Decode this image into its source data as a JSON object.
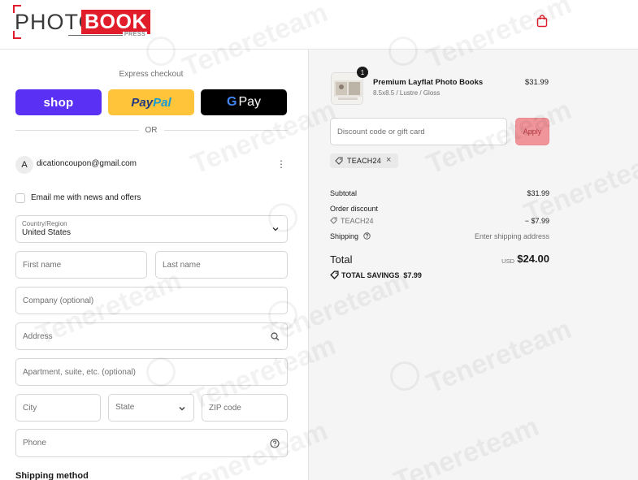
{
  "brand": {
    "photo_text": "PHOTO",
    "book_text": "BOOK",
    "press_text": "PRESS",
    "accent_color": "#e11d2b"
  },
  "header": {
    "cart_icon": "shopping-bag-icon"
  },
  "express": {
    "label": "Express checkout",
    "shop_label": "shop",
    "paypal_label_1": "Pay",
    "paypal_label_2": "Pal",
    "gpay_g": "G",
    "gpay_label": "Pay",
    "or_label": "OR"
  },
  "account": {
    "avatar_letter": "A",
    "email": "dicationcoupon@gmail.com",
    "menu_icon": "more-vertical-icon"
  },
  "newsletter": {
    "label": "Email me with news and offers",
    "checked": false
  },
  "form": {
    "country_label": "Country/Region",
    "country_value": "United States",
    "first_name_placeholder": "First name",
    "last_name_placeholder": "Last name",
    "company_placeholder": "Company (optional)",
    "address_placeholder": "Address",
    "apartment_placeholder": "Apartment, suite, etc. (optional)",
    "city_placeholder": "City",
    "state_placeholder": "State",
    "zip_placeholder": "ZIP code",
    "phone_placeholder": "Phone"
  },
  "shipping_method_heading": "Shipping method",
  "order": {
    "item": {
      "quantity": "1",
      "name": "Premium Layflat Photo Books",
      "variant": "8.5x8.5 / Lustre / Gloss",
      "price": "$31.99"
    },
    "discount_placeholder": "Discount code or gift card",
    "apply_label": "Apply",
    "applied_code": "TEACH24",
    "subtotal_label": "Subtotal",
    "subtotal_value": "$31.99",
    "order_discount_label": "Order discount",
    "discount_code": "TEACH24",
    "discount_value": "− $7.99",
    "shipping_label": "Shipping",
    "shipping_value": "Enter shipping address",
    "total_label": "Total",
    "currency": "USD",
    "total_value": "$24.00",
    "savings_label": "TOTAL SAVINGS",
    "savings_value": "$7.99"
  },
  "watermark": "Tenereteam"
}
